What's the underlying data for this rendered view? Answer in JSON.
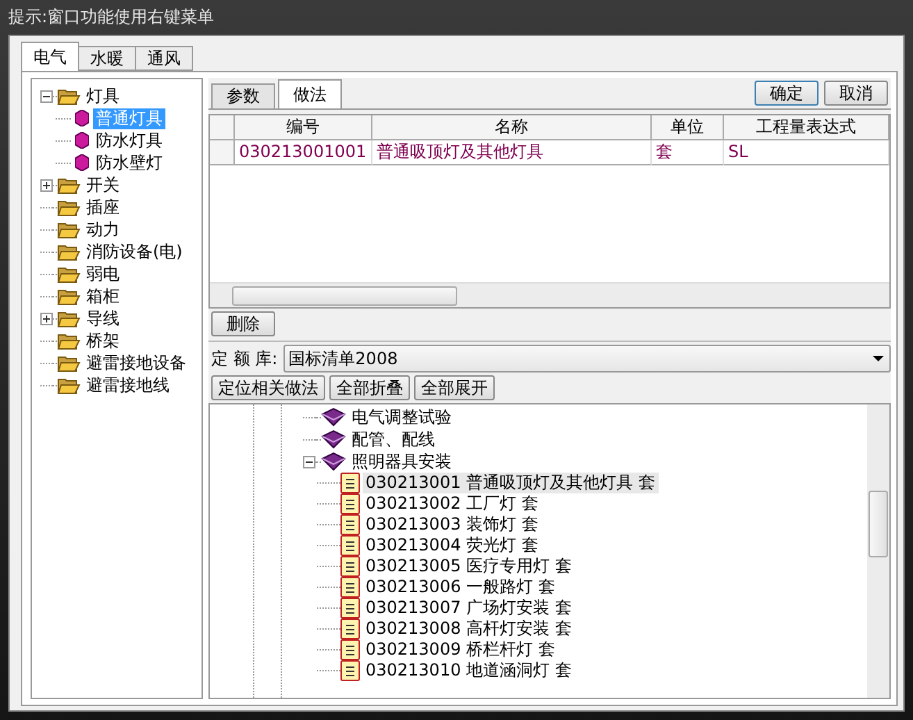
{
  "window": {
    "title": "提示:窗口功能使用右键菜单"
  },
  "tabs": [
    {
      "label": "电气",
      "selected": true
    },
    {
      "label": "水暖",
      "selected": false
    },
    {
      "label": "通风",
      "selected": false
    }
  ],
  "category_tree": [
    {
      "label": "灯具",
      "expanded": true,
      "selected": false,
      "children": [
        {
          "label": "普通灯具",
          "selected": true
        },
        {
          "label": "防水灯具",
          "selected": false
        },
        {
          "label": "防水壁灯",
          "selected": false
        }
      ]
    },
    {
      "label": "开关",
      "expanded": false,
      "selected": false
    },
    {
      "label": "插座",
      "selected": false
    },
    {
      "label": "动力",
      "selected": false
    },
    {
      "label": "消防设备(电)",
      "selected": false
    },
    {
      "label": "弱电",
      "selected": false
    },
    {
      "label": "箱柜",
      "selected": false
    },
    {
      "label": "导线",
      "expanded": false,
      "selected": false
    },
    {
      "label": "桥架",
      "selected": false
    },
    {
      "label": "避雷接地设备",
      "selected": false
    },
    {
      "label": "避雷接地线",
      "selected": false
    }
  ],
  "sub_tabs": [
    {
      "label": "参数",
      "selected": false
    },
    {
      "label": "做法",
      "selected": true
    }
  ],
  "dialog_buttons": [
    "确定",
    "取消"
  ],
  "table": {
    "columns": [
      "编号",
      "名称",
      "单位",
      "工程量表达式"
    ],
    "rows": [
      [
        "030213001001",
        "普通吸顶灯及其他灯具",
        "套",
        "SL"
      ]
    ]
  },
  "delete_button": "删除",
  "quota_library": {
    "label": "定 额 库:",
    "value": "国标清单2008"
  },
  "tree_buttons": [
    "定位相关做法",
    "全部折叠",
    "全部展开"
  ],
  "quota_tree": [
    {
      "label": "电气调整试验"
    },
    {
      "label": "配管、配线"
    },
    {
      "label": "照明器具安装",
      "expanded": true,
      "children": [
        {
          "code": "030213001",
          "name": "普通吸顶灯及其他灯具",
          "unit": "套",
          "selected": true
        },
        {
          "code": "030213002",
          "name": "工厂灯",
          "unit": "套",
          "selected": false
        },
        {
          "code": "030213003",
          "name": "装饰灯",
          "unit": "套",
          "selected": false
        },
        {
          "code": "030213004",
          "name": "荧光灯",
          "unit": "套",
          "selected": false
        },
        {
          "code": "030213005",
          "name": "医疗专用灯",
          "unit": "套",
          "selected": false
        },
        {
          "code": "030213006",
          "name": "一般路灯",
          "unit": "套",
          "selected": false
        },
        {
          "code": "030213007",
          "name": "广场灯安装",
          "unit": "套",
          "selected": false
        },
        {
          "code": "030213008",
          "name": "高杆灯安装",
          "unit": "套",
          "selected": false
        },
        {
          "code": "030213009",
          "name": "桥栏杆灯",
          "unit": "套",
          "selected": false
        },
        {
          "code": "030213010",
          "name": "地道涵洞灯",
          "unit": "套",
          "selected": false
        }
      ]
    }
  ]
}
